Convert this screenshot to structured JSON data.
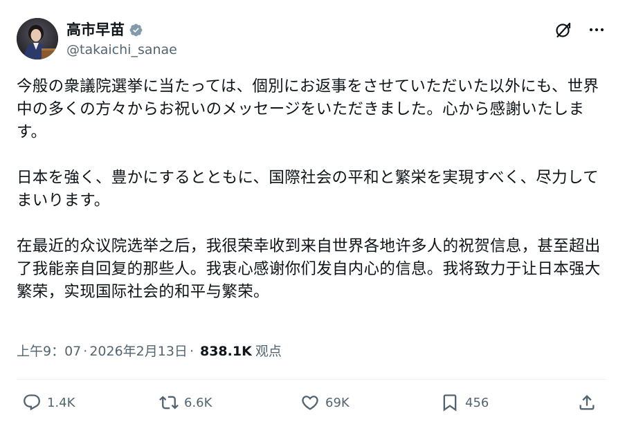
{
  "author": {
    "name": "高市早苗",
    "handle": "@takaichi_sanae",
    "verified": true
  },
  "header": {
    "icons": [
      "grok-icon",
      "more-icon"
    ]
  },
  "tweet": {
    "paragraphs": [
      "今般の衆議院選挙に当たっては、個別にお返事をさせていただいた以外にも、世界中の多くの方々からお祝いのメッセージをいただきました。心から感謝いたします。",
      "日本を強く、豊かにするとともに、国際社会の平和と繁栄を実現すべく、尽力してまいります。",
      "在最近的众议院选举之后，我很荣幸收到来自世界各地许多人的祝贺信息，甚至超出了我能亲自回复的那些人。我衷心感谢你们发自内心的信息。我将致力于让日本强大繁荣，实现国际社会的和平与繁荣。"
    ]
  },
  "meta": {
    "time": "上午9：07",
    "separator": "·",
    "date": "2026年2月13日",
    "views_count": "838.1K",
    "views_label": "观点"
  },
  "actions": {
    "reply": {
      "icon": "reply-icon",
      "count": "1.4K"
    },
    "repost": {
      "icon": "repost-icon",
      "count": "6.6K"
    },
    "like": {
      "icon": "heart-icon",
      "count": "69K"
    },
    "bookmark": {
      "icon": "bookmark-icon",
      "count": "456"
    },
    "share": {
      "icon": "share-icon"
    }
  },
  "colors": {
    "text": "#0f1419",
    "secondary": "#536471",
    "verified": "#829aab",
    "divider": "#eff3f4"
  }
}
